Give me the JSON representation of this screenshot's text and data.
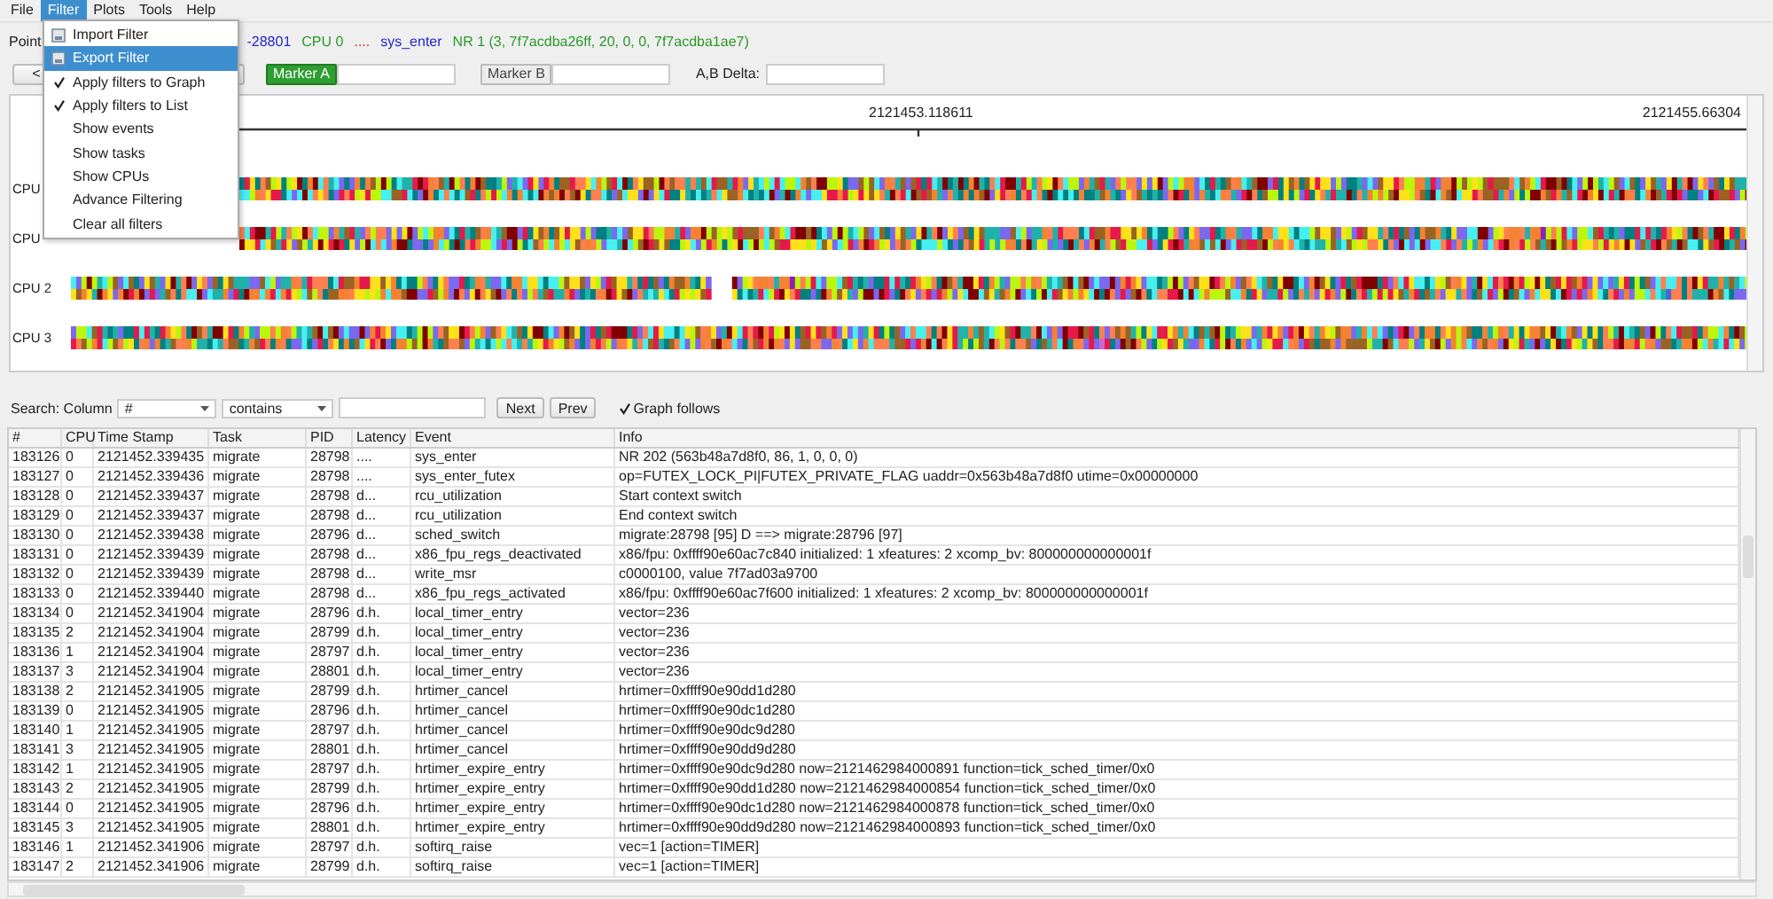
{
  "menubar": [
    {
      "label": "File",
      "selected": false
    },
    {
      "label": "Filter",
      "selected": true
    },
    {
      "label": "Plots",
      "selected": false
    },
    {
      "label": "Tools",
      "selected": false
    },
    {
      "label": "Help",
      "selected": false
    }
  ],
  "filter_menu": [
    {
      "kind": "icon",
      "label": "Import Filter",
      "selected": false
    },
    {
      "kind": "icon",
      "label": "Export Filter",
      "selected": true
    },
    {
      "kind": "check",
      "label": "Apply filters to Graph",
      "checked": true,
      "selected": false
    },
    {
      "kind": "check",
      "label": "Apply filters to List",
      "checked": true,
      "selected": false
    },
    {
      "kind": "plain",
      "label": "Show events",
      "selected": false
    },
    {
      "kind": "plain",
      "label": "Show tasks",
      "selected": false
    },
    {
      "kind": "plain",
      "label": "Show CPUs",
      "selected": false
    },
    {
      "kind": "plain",
      "label": "Advance Filtering",
      "selected": false
    },
    {
      "kind": "plain",
      "label": "Clear all filters",
      "selected": false
    }
  ],
  "pointer": {
    "label": "Point",
    "task": "-28801",
    "cpu": "CPU 0",
    "latency": "....",
    "event": "sys_enter",
    "info": "NR 1 (3, 7f7acdba26ff, 20, 0, 0, 7f7acdba1ae7)"
  },
  "nav_button": "<",
  "marker_a": {
    "label": "Marker A",
    "selected": true
  },
  "marker_b": {
    "label": "Marker B",
    "selected": false
  },
  "delta_label": "A,B Delta:",
  "graph": {
    "ticks": [
      "2121453.118611",
      "2121455.66304"
    ],
    "cpus": [
      "CPU",
      "CPU",
      "CPU 2",
      "CPU 3"
    ]
  },
  "search": {
    "label": "Search: Column",
    "column": "#",
    "mode": "contains",
    "next": "Next",
    "prev": "Prev",
    "graph_follows": {
      "label": "Graph follows",
      "checked": true
    }
  },
  "table": {
    "columns": [
      "#",
      "CPU",
      "Time Stamp",
      "Task",
      "PID",
      "Latency",
      "Event",
      "Info"
    ],
    "rows": [
      [
        "183126",
        "0",
        "2121452.339435",
        "migrate",
        "28798",
        "....",
        "sys_enter",
        "NR 202 (563b48a7d8f0, 86, 1, 0, 0, 0)"
      ],
      [
        "183127",
        "0",
        "2121452.339436",
        "migrate",
        "28798",
        "....",
        "sys_enter_futex",
        "op=FUTEX_LOCK_PI|FUTEX_PRIVATE_FLAG uaddr=0x563b48a7d8f0 utime=0x00000000"
      ],
      [
        "183128",
        "0",
        "2121452.339437",
        "migrate",
        "28798",
        "d...",
        "rcu_utilization",
        "Start context switch"
      ],
      [
        "183129",
        "0",
        "2121452.339437",
        "migrate",
        "28798",
        "d...",
        "rcu_utilization",
        "End context switch"
      ],
      [
        "183130",
        "0",
        "2121452.339438",
        "migrate",
        "28796",
        "d...",
        "sched_switch",
        "migrate:28798 [95] D ==> migrate:28796 [97]"
      ],
      [
        "183131",
        "0",
        "2121452.339439",
        "migrate",
        "28798",
        "d...",
        "x86_fpu_regs_deactivated",
        "x86/fpu: 0xffff90e60ac7c840 initialized: 1 xfeatures: 2 xcomp_bv: 800000000000001f"
      ],
      [
        "183132",
        "0",
        "2121452.339439",
        "migrate",
        "28798",
        "d...",
        "write_msr",
        "c0000100, value 7f7ad03a9700"
      ],
      [
        "183133",
        "0",
        "2121452.339440",
        "migrate",
        "28798",
        "d...",
        "x86_fpu_regs_activated",
        "x86/fpu: 0xffff90e60ac7f600 initialized: 1 xfeatures: 2 xcomp_bv: 800000000000001f"
      ],
      [
        "183134",
        "0",
        "2121452.341904",
        "migrate",
        "28796",
        "d.h.",
        "local_timer_entry",
        "vector=236"
      ],
      [
        "183135",
        "2",
        "2121452.341904",
        "migrate",
        "28799",
        "d.h.",
        "local_timer_entry",
        "vector=236"
      ],
      [
        "183136",
        "1",
        "2121452.341904",
        "migrate",
        "28797",
        "d.h.",
        "local_timer_entry",
        "vector=236"
      ],
      [
        "183137",
        "3",
        "2121452.341904",
        "migrate",
        "28801",
        "d.h.",
        "local_timer_entry",
        "vector=236"
      ],
      [
        "183138",
        "2",
        "2121452.341905",
        "migrate",
        "28799",
        "d.h.",
        "hrtimer_cancel",
        "hrtimer=0xffff90e90dd1d280"
      ],
      [
        "183139",
        "0",
        "2121452.341905",
        "migrate",
        "28796",
        "d.h.",
        "hrtimer_cancel",
        "hrtimer=0xffff90e90dc1d280"
      ],
      [
        "183140",
        "1",
        "2121452.341905",
        "migrate",
        "28797",
        "d.h.",
        "hrtimer_cancel",
        "hrtimer=0xffff90e90dc9d280"
      ],
      [
        "183141",
        "3",
        "2121452.341905",
        "migrate",
        "28801",
        "d.h.",
        "hrtimer_cancel",
        "hrtimer=0xffff90e90dd9d280"
      ],
      [
        "183142",
        "1",
        "2121452.341905",
        "migrate",
        "28797",
        "d.h.",
        "hrtimer_expire_entry",
        "hrtimer=0xffff90e90dc9d280 now=2121462984000891 function=tick_sched_timer/0x0"
      ],
      [
        "183143",
        "2",
        "2121452.341905",
        "migrate",
        "28799",
        "d.h.",
        "hrtimer_expire_entry",
        "hrtimer=0xffff90e90dd1d280 now=2121462984000854 function=tick_sched_timer/0x0"
      ],
      [
        "183144",
        "0",
        "2121452.341905",
        "migrate",
        "28796",
        "d.h.",
        "hrtimer_expire_entry",
        "hrtimer=0xffff90e90dc1d280 now=2121462984000878 function=tick_sched_timer/0x0"
      ],
      [
        "183145",
        "3",
        "2121452.341905",
        "migrate",
        "28801",
        "d.h.",
        "hrtimer_expire_entry",
        "hrtimer=0xffff90e90dd9d280 now=2121462984000893 function=tick_sched_timer/0x0"
      ],
      [
        "183146",
        "1",
        "2121452.341906",
        "migrate",
        "28797",
        "d.h.",
        "softirq_raise",
        "vec=1 [action=TIMER]"
      ],
      [
        "183147",
        "2",
        "2121452.341906",
        "migrate",
        "28799",
        "d.h.",
        "softirq_raise",
        "vec=1 [action=TIMER]"
      ]
    ]
  }
}
